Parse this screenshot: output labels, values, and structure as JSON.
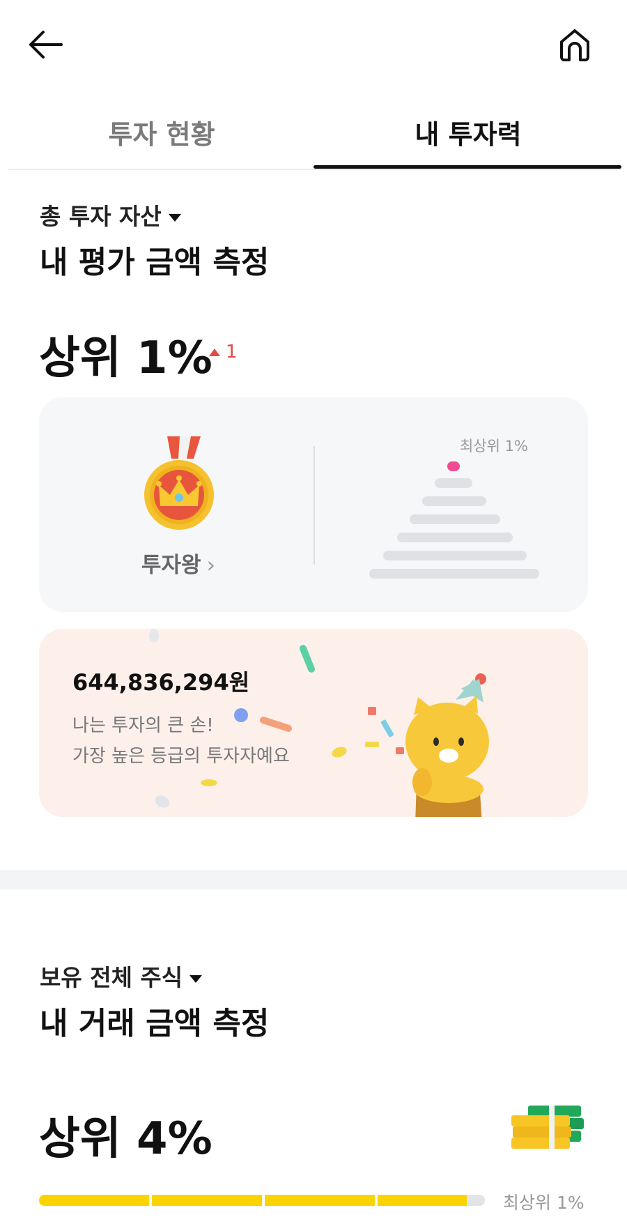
{
  "tabs": [
    {
      "label": "투자 현황",
      "selected": false
    },
    {
      "label": "내 투자력",
      "selected": true
    }
  ],
  "section1": {
    "subtitle": "총 투자 자산",
    "title": "내 평가 금액 측정",
    "rank": "상위 1%",
    "rank_change": "1",
    "grade_name": "투자왕",
    "pyramid_label": "최상위 1%"
  },
  "promo": {
    "amount": "644,836,294원",
    "line1": "나는 투자의 큰 손!",
    "line2": "가장 높은 등급의 투자자예요"
  },
  "section2": {
    "subtitle": "보유 전체 주식",
    "title": "내 거래 금액 측정",
    "rank": "상위 4%",
    "progress_fraction": 0.96,
    "progress_label": "최상위 1%"
  },
  "colors": {
    "accent_yellow": "#fbd400",
    "rank_up_red": "#e44a45",
    "top_rank_pink": "#ef4c93"
  },
  "icons": {
    "back": "arrow-left-icon",
    "home": "home-icon",
    "grade": "crown-medal-icon",
    "money": "money-stack-icon"
  }
}
